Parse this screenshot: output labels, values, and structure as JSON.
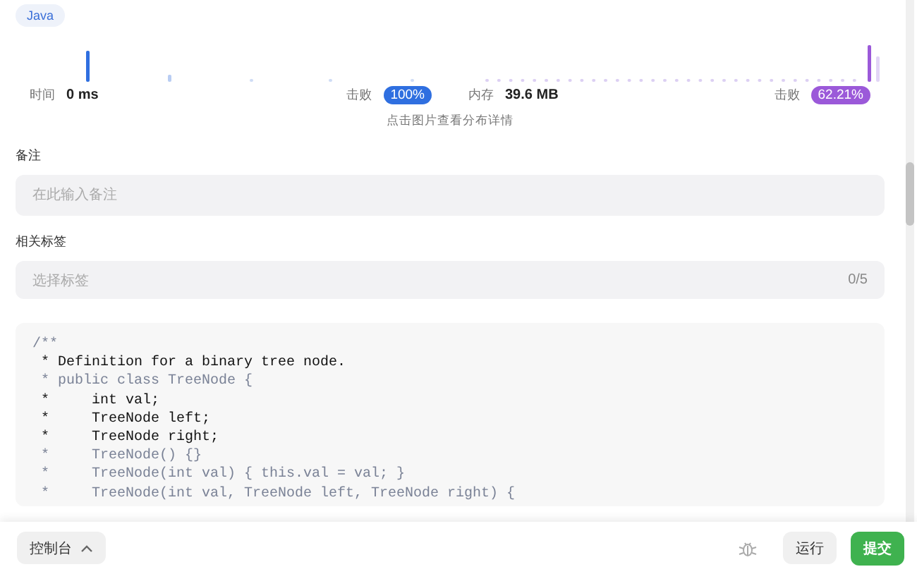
{
  "language_tag": "Java",
  "stats": [
    {
      "kind": "runtime",
      "label": "时间",
      "value": "0 ms",
      "beat_label": "击败",
      "percent": "100%"
    },
    {
      "kind": "memory",
      "label": "内存",
      "value": "39.6 MB",
      "beat_label": "击败",
      "percent": "62.21%"
    }
  ],
  "chart_hint": "点击图片查看分布详情",
  "note": {
    "label": "备注",
    "placeholder": "在此输入备注"
  },
  "tags": {
    "label": "相关标签",
    "placeholder": "选择标签",
    "count": "0/5"
  },
  "code_lines": [
    {
      "text": "/**",
      "kind": "muted"
    },
    {
      "text": " * Definition for a binary tree node.",
      "kind": "strong"
    },
    {
      "text": " * public class TreeNode {",
      "kind": "muted"
    },
    {
      "text": " *     int val;",
      "kind": "strong"
    },
    {
      "text": " *     TreeNode left;",
      "kind": "strong"
    },
    {
      "text": " *     TreeNode right;",
      "kind": "strong"
    },
    {
      "text": " *     TreeNode() {}",
      "kind": "muted"
    },
    {
      "text": " *     TreeNode(int val) { this.val = val; }",
      "kind": "muted"
    },
    {
      "text": " *     TreeNode(int val, TreeNode left, TreeNode right) {",
      "kind": "muted"
    }
  ],
  "footer": {
    "console": "控制台",
    "run": "运行",
    "submit": "提交"
  }
}
